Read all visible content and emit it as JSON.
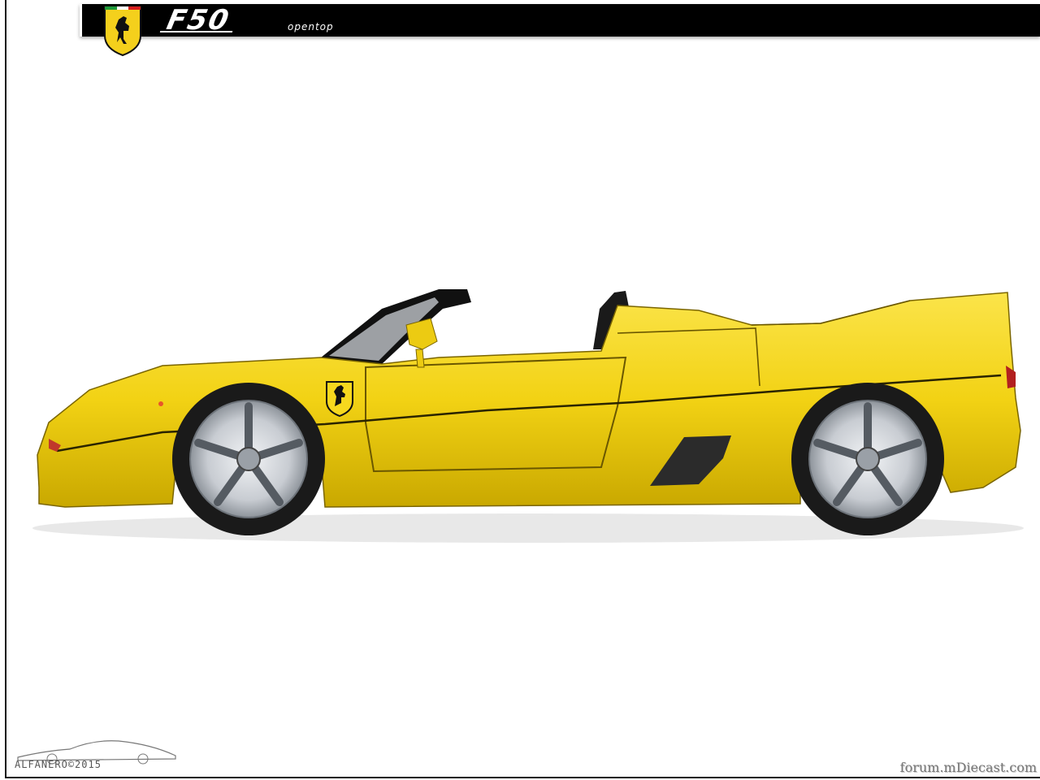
{
  "header": {
    "model": "F50",
    "variant": "opentop"
  },
  "credits": {
    "author": "ALFANERO©2015",
    "site": "forum.mDiecast.com"
  },
  "colors": {
    "body": "#f2d214",
    "body_shadow": "#c9a800",
    "tire": "#1a1a1a",
    "rim": "#cfd3d8",
    "bar": "#000000"
  },
  "icons": {
    "shield": "prancing-horse-shield-icon"
  }
}
